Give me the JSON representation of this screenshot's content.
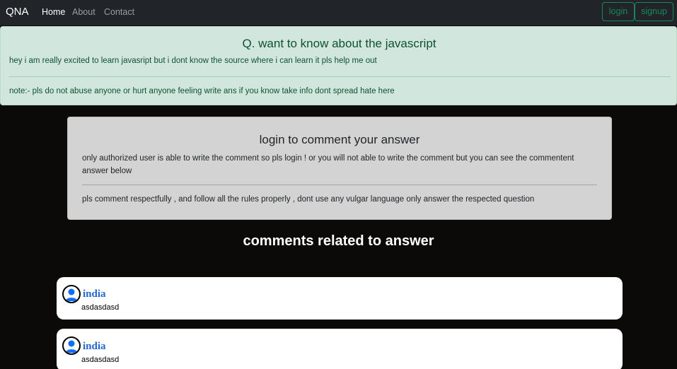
{
  "navbar": {
    "brand": "QNA",
    "links": [
      {
        "label": "Home",
        "active": true
      },
      {
        "label": "About",
        "active": false
      },
      {
        "label": "Contact",
        "active": false
      }
    ],
    "login_label": "login",
    "signup_label": "signup"
  },
  "question": {
    "title": "Q. want to know about the javascript",
    "body": "hey i am really excited to learn javasript but i dont know the source where i can learn it pls help me out",
    "note": "note:- pls do not abuse anyone or hurt anyone feeling write ans if you know take info dont spread hate here"
  },
  "login_notice": {
    "title": "login to comment your answer",
    "body": "only authorized user is able to write the comment so pls login ! or you will not able to write the comment but you can see the commentent answer below",
    "rules": "pls comment respectfully , and follow all the rules properly , dont use any vulgar language only answer the respected question"
  },
  "comments_heading": "comments related to answer",
  "comments": [
    {
      "user": "india",
      "text": "asdasdasd",
      "icon": "user-avatar-icon"
    },
    {
      "user": "india",
      "text": "asdasdasd",
      "icon": "user-avatar-icon"
    }
  ],
  "colors": {
    "navbar_bg": "#212529",
    "alert_bg": "#d1e7dd",
    "alert_text": "#0f5132",
    "outline_success": "#198754",
    "login_box_bg": "#d3d3d3",
    "page_bg": "#0b0a09",
    "username": "#2366d1",
    "avatar_blue": "#0d6efd"
  }
}
